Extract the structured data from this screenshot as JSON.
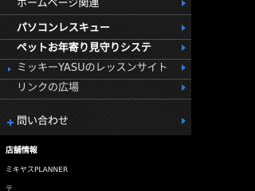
{
  "menu": {
    "items": [
      {
        "label": "ホームページ関連"
      },
      {
        "label": "パソコンレスキュー"
      },
      {
        "label": "ペットお年寄り見守りシステ"
      },
      {
        "label": "ミッキーYASUのレッスンサイト"
      },
      {
        "label": "リンクの広場"
      },
      {
        "label": "問い合わせ"
      }
    ],
    "arrow_icon": "chevron-right-icon",
    "accent_color": "#2f7bd9"
  },
  "shop": {
    "title": "店舗情報",
    "name": "ミキヤスPLANNER",
    "partial_line": "テ"
  }
}
